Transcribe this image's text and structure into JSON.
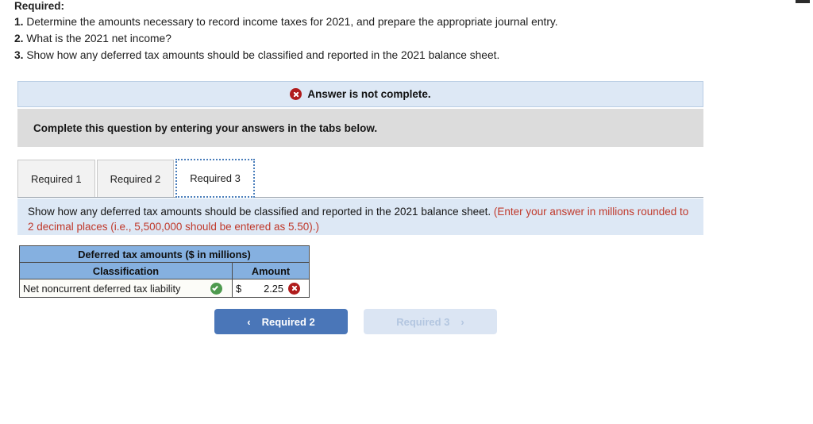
{
  "requirements": {
    "heading": "Required:",
    "items": [
      {
        "num": "1.",
        "text": "Determine the amounts necessary to record income taxes for 2021, and prepare the appropriate journal entry."
      },
      {
        "num": "2.",
        "text": "What is the 2021 net income?"
      },
      {
        "num": "3.",
        "text": "Show how any deferred tax amounts should be classified and reported in the 2021 balance sheet."
      }
    ]
  },
  "status_banner": {
    "icon": "error-x-icon",
    "label": "Answer is not complete."
  },
  "instruction_band": {
    "text": "Complete this question by entering your answers in the tabs below."
  },
  "tabs": [
    {
      "label": "Required 1",
      "active": false
    },
    {
      "label": "Required 2",
      "active": false
    },
    {
      "label": "Required 3",
      "active": true
    }
  ],
  "question_panel": {
    "text": "Show how any deferred tax amounts should be classified and reported in the 2021 balance sheet.",
    "note": "(Enter your answer in millions rounded to 2 decimal places (i.e., 5,500,000 should be entered as 5.50).)"
  },
  "answer_table": {
    "title": "Deferred tax amounts ($ in millions)",
    "columns": [
      "Classification",
      "Amount"
    ],
    "rows": [
      {
        "classification": "Net noncurrent deferred tax liability",
        "classification_status": "correct",
        "currency": "$",
        "amount": "2.25",
        "amount_status": "incorrect"
      }
    ]
  },
  "navigation": {
    "prev": {
      "label": "Required 2",
      "chevron": "‹",
      "state": "enabled"
    },
    "next": {
      "label": "Required 3",
      "chevron": "›",
      "state": "disabled"
    }
  },
  "colors": {
    "banner_bg": "#dde8f5",
    "band_bg": "#dcdcdc",
    "table_header": "#85b0e0",
    "primary_button": "#4a76b8",
    "disabled_button": "#dbe5f3",
    "note_red": "#c0392b",
    "error_red": "#b01c1c",
    "success_green": "#4e9a4e"
  }
}
